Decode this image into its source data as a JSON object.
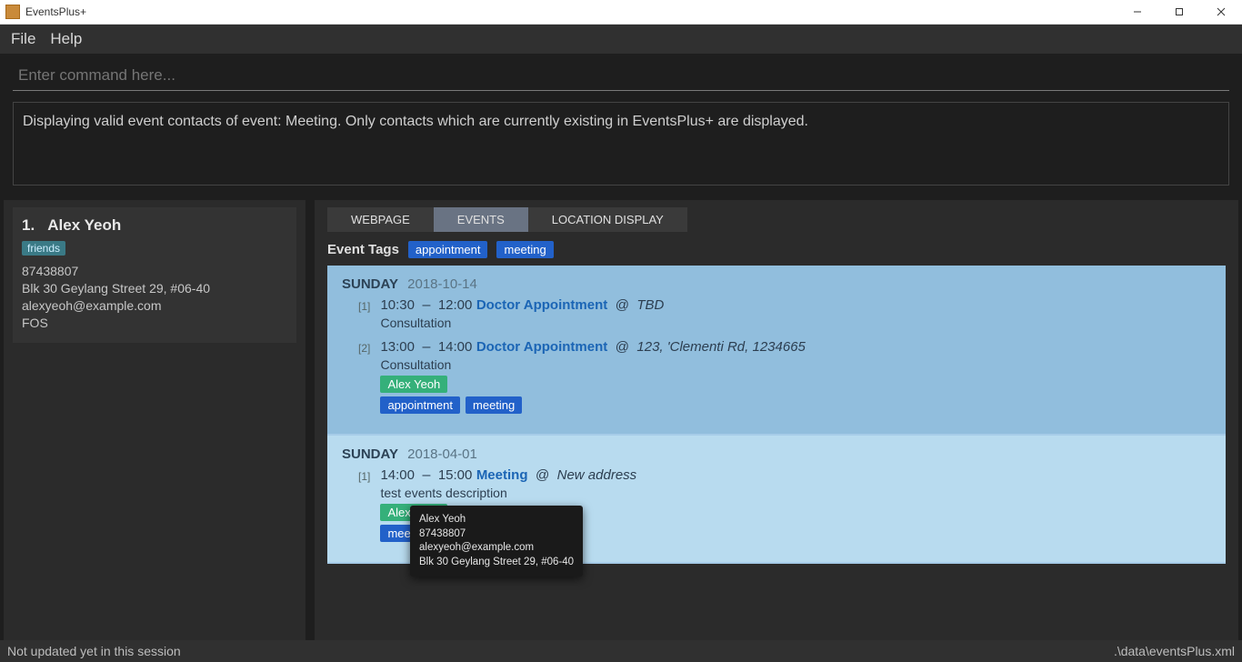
{
  "window": {
    "title": "EventsPlus+"
  },
  "menu": {
    "file": "File",
    "help": "Help"
  },
  "command": {
    "placeholder": "Enter command here..."
  },
  "result": {
    "message": "Displaying valid event contacts of event: Meeting. Only contacts which are currently existing in EventsPlus+ are displayed."
  },
  "sidebar": {
    "person": {
      "index": "1.",
      "name": "Alex Yeoh",
      "tag": "friends",
      "phone": "87438807",
      "address": "Blk 30 Geylang Street 29, #06-40",
      "email": "alexyeoh@example.com",
      "faculty": "FOS"
    }
  },
  "tabs": {
    "webpage": "WEBPAGE",
    "events": "EVENTS",
    "location": "LOCATION DISPLAY"
  },
  "eventTags": {
    "label": "Event Tags",
    "items": [
      "appointment",
      "meeting"
    ]
  },
  "days": [
    {
      "dow": "SUNDAY",
      "date": "2018-10-14",
      "shade": "mid",
      "events": [
        {
          "idx": "[1]",
          "start": "10:30",
          "end": "12:00",
          "title": "Doctor Appointment",
          "location": "TBD",
          "desc": "Consultation",
          "people": [],
          "tags": []
        },
        {
          "idx": "[2]",
          "start": "13:00",
          "end": "14:00",
          "title": "Doctor Appointment",
          "location": "123, 'Clementi Rd, 1234665",
          "desc": "Consultation",
          "people": [
            "Alex Yeoh"
          ],
          "tags": [
            "appointment",
            "meeting"
          ]
        }
      ]
    },
    {
      "dow": "SUNDAY",
      "date": "2018-04-01",
      "shade": "light",
      "events": [
        {
          "idx": "[1]",
          "start": "14:00",
          "end": "15:00",
          "title": "Meeting",
          "location": "New address",
          "desc": "test events description",
          "people": [
            "Alex Yeoh"
          ],
          "tags": [
            "meeting"
          ]
        }
      ]
    }
  ],
  "tooltip": {
    "name": "Alex Yeoh",
    "phone": "87438807",
    "email": "alexyeoh@example.com",
    "address": "Blk 30 Geylang Street 29, #06-40"
  },
  "status": {
    "left": "Not updated yet in this session",
    "right": ".\\data\\eventsPlus.xml"
  },
  "glyph": {
    "at": "@",
    "dash": "–"
  }
}
